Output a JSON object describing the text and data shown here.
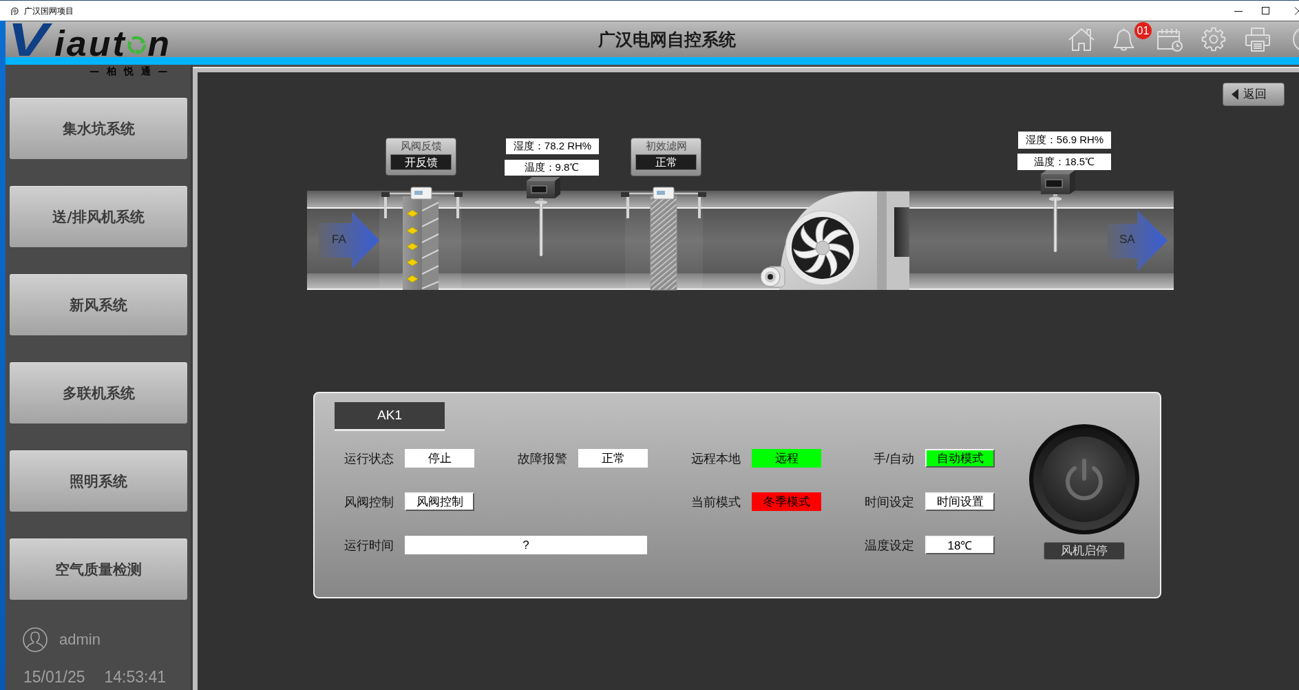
{
  "window": {
    "title": "广汉国网项目"
  },
  "header": {
    "logo": {
      "initial": "V",
      "middle": "iaut",
      "tail": "n",
      "tagline": "— 柏 悦 通 —"
    },
    "title": "广汉电网自控系统",
    "notification_badge": "01"
  },
  "sidebar": {
    "items": [
      {
        "label": "集水坑系统",
        "selected": false
      },
      {
        "label": "送/排风机系统",
        "selected": false
      },
      {
        "label": "新风系统",
        "selected": false
      },
      {
        "label": "多联机系统",
        "selected": false
      },
      {
        "label": "照明系统",
        "selected": false
      },
      {
        "label": "空气质量检测",
        "selected": false
      }
    ],
    "user": "admin",
    "date": "15/01/25",
    "time": "14:53:41"
  },
  "back_button": {
    "label": "返回"
  },
  "diagram": {
    "inlet_label": "FA",
    "damper_feedback": {
      "title": "风阀反馈",
      "value": "开反馈"
    },
    "sensors": [
      {
        "humidity": "湿度：78.2 RH%",
        "temperature": "温度：9.8℃"
      },
      {
        "humidity": "湿度：56.9 RH%",
        "temperature": "温度：18.5℃"
      }
    ],
    "filter": {
      "title": "初效滤网",
      "value": "正常"
    },
    "outlet_label": "SA"
  },
  "panel": {
    "title": "AK1",
    "rows": [
      [
        {
          "label": "运行状态",
          "value": "停止",
          "kind": "display",
          "color": "#ffffff"
        },
        {
          "label": "故障报警",
          "value": "正常",
          "kind": "display",
          "color": "#ffffff"
        },
        {
          "label": "远程本地",
          "value": "远程",
          "kind": "display",
          "color": "#00ff00"
        },
        {
          "label": "手/自动",
          "value": "自动模式",
          "kind": "button",
          "color": "#00ff00"
        }
      ],
      [
        {
          "label": "风阀控制",
          "value": "风阀控制",
          "kind": "button",
          "color": "#ffffff"
        },
        "",
        {
          "label": "当前模式",
          "value": "冬季模式",
          "kind": "display",
          "color": "#ff0000"
        },
        {
          "label": "时间设定",
          "value": "时间设置",
          "kind": "button",
          "color": "#ffffff"
        }
      ],
      [
        {
          "label": "运行时间",
          "value": "?",
          "kind": "display",
          "color": "#ffffff",
          "wide": true
        },
        "",
        "",
        {
          "label": "温度设定",
          "value": "18℃",
          "kind": "input",
          "color": "#ffffff"
        }
      ]
    ],
    "fan_switch": {
      "label": "风机启停"
    }
  }
}
